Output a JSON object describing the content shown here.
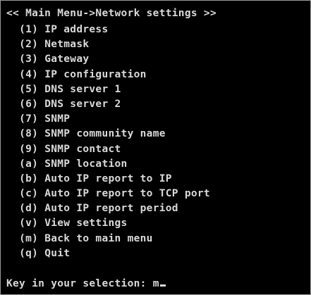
{
  "header": {
    "title": "<< Main Menu->Network settings >>"
  },
  "menu": {
    "items": [
      {
        "key": "(1)",
        "label": "IP address"
      },
      {
        "key": "(2)",
        "label": "Netmask"
      },
      {
        "key": "(3)",
        "label": "Gateway"
      },
      {
        "key": "(4)",
        "label": "IP configuration"
      },
      {
        "key": "(5)",
        "label": "DNS server 1"
      },
      {
        "key": "(6)",
        "label": "DNS server 2"
      },
      {
        "key": "(7)",
        "label": "SNMP"
      },
      {
        "key": "(8)",
        "label": "SNMP community name"
      },
      {
        "key": "(9)",
        "label": "SNMP contact"
      },
      {
        "key": "(a)",
        "label": "SNMP location"
      },
      {
        "key": "(b)",
        "label": "Auto IP report to IP"
      },
      {
        "key": "(c)",
        "label": "Auto IP report to TCP port"
      },
      {
        "key": "(d)",
        "label": "Auto IP report period"
      },
      {
        "key": "(v)",
        "label": "View settings"
      },
      {
        "key": "(m)",
        "label": "Back to main menu"
      },
      {
        "key": "(q)",
        "label": "Quit"
      }
    ]
  },
  "prompt": {
    "label": "Key in your selection:",
    "value": "m"
  },
  "colors": {
    "background": "#000000",
    "text": "#d9d9d9"
  }
}
